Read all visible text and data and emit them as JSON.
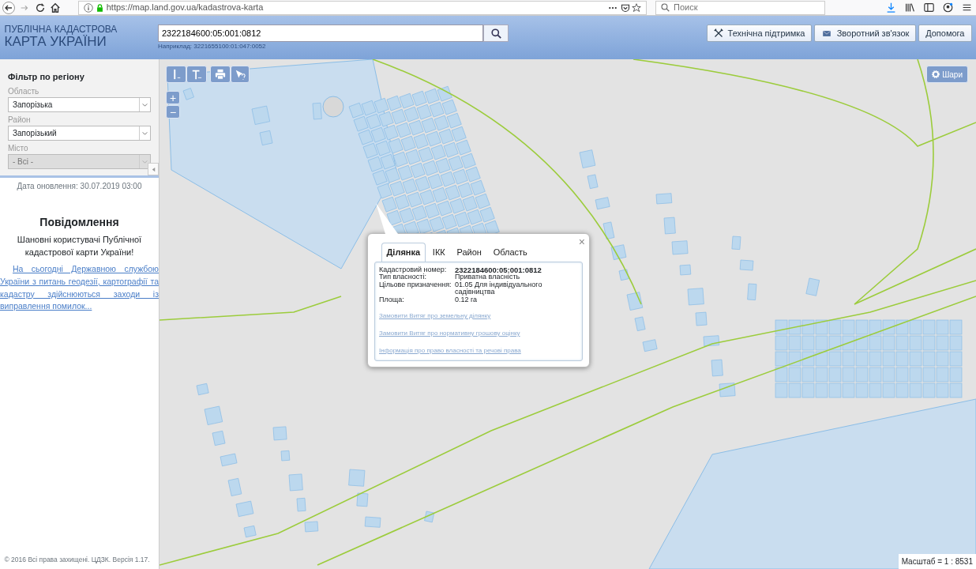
{
  "browser": {
    "url": "https://map.land.gov.ua/kadastrova-karta",
    "search_placeholder": "Поиск"
  },
  "header": {
    "title_line1": "ПУБЛІЧНА КАДАСТРОВА",
    "title_line2": "КАРТА УКРАЇНИ",
    "search_value": "2322184600:05:001:0812",
    "search_example": "Наприклад: 3221655100:01:047:0052",
    "buttons": [
      {
        "kind": "tools",
        "label": "Технічна підтримка"
      },
      {
        "kind": "mail",
        "label": "Зворотний зв'язок"
      },
      {
        "kind": "plain",
        "label": "Допомога"
      }
    ]
  },
  "sidebar": {
    "filter_title": "Фільтр по регіону",
    "fields": [
      {
        "label": "Область",
        "value": "Запорізька",
        "disabled": false
      },
      {
        "label": "Район",
        "value": "Запорізький",
        "disabled": false
      },
      {
        "label": "Місто",
        "value": "- Всі -",
        "disabled": true
      }
    ],
    "update_date": "Дата оновлення: 30.07.2019 03:00",
    "notice_title": "Повідомлення",
    "notice_text": "Шановні користувачі Публічної кадастрової карти України!",
    "notice_link": "На сьогодні Державною службою України з питань геодезії, картографії та кадастру здійснюються заходи із виправлення помилок...",
    "footer": "© 2016 Всі права захищені. ЦДЗК. Версія 1.17."
  },
  "map": {
    "layers_button": "Шари",
    "zoom_in": "+",
    "zoom_out": "−",
    "scale": "Масштаб = 1 : 8531",
    "popup": {
      "close": "×",
      "tabs": [
        {
          "label": "Ділянка",
          "selected": true
        },
        {
          "label": "ІКК",
          "selected": false
        },
        {
          "label": "Район",
          "selected": false
        },
        {
          "label": "Область",
          "selected": false
        }
      ],
      "rows": [
        {
          "label": "Кадастровий номер:",
          "value": "2322184600:05:001:0812",
          "bold": true
        },
        {
          "label": "Тип власності:",
          "value": "Приватна власність",
          "bold": false
        },
        {
          "label": "Цільове призначення:",
          "value": "01.05 Для індивідуального садівництва",
          "bold": false
        },
        {
          "label": "Площа:",
          "value": "0.12 га",
          "bold": false
        }
      ],
      "links": [
        "Замовити Витяг про земельну ділянку",
        "Замовити Витяг про нормативну грошову оцінку",
        "Інформація про право власності та речові права"
      ]
    }
  }
}
